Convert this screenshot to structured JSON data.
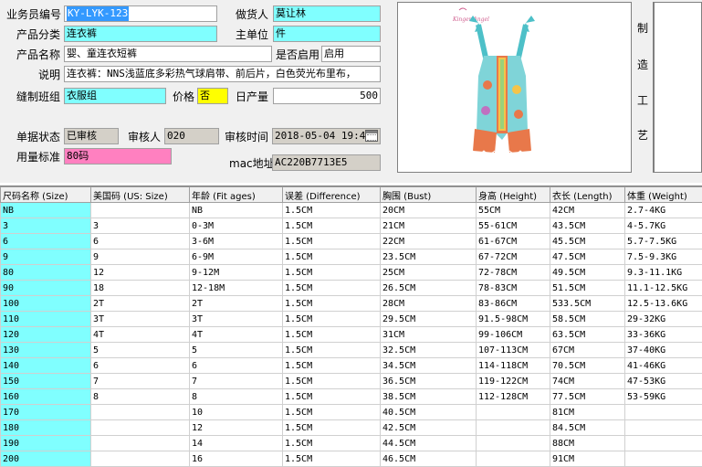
{
  "form": {
    "emp_label": "业务员编号",
    "emp_value": "KY-LYK-123",
    "maker_label": "做货人",
    "maker_value": "莫让林",
    "cat_label": "产品分类",
    "cat_value": "连衣裤",
    "unit_label": "主单位",
    "unit_value": "件",
    "name_label": "产品名称",
    "name_value": "婴、童连衣短裤",
    "enabled_label": "是否启用",
    "enabled_value": "启用",
    "desc_label": "说明",
    "desc_value": "连衣裤：NNS浅蓝底多彩热气球肩带、前后片，白色荧光布里布，",
    "team_label": "缝制班组",
    "team_value": "衣服组",
    "price_label": "价格",
    "price_value": "否",
    "daily_label": "日产量",
    "daily_value": "500",
    "status_label": "单据状态",
    "status_value": "已审核",
    "reviewer_label": "审核人",
    "reviewer_value": "020",
    "time_label": "审核时间",
    "time_value": "2018-05-04  19:4",
    "usage_label": "用量标准",
    "usage_value": "80码",
    "mac_label": "mac地址",
    "mac_value": "AC220B7713E5"
  },
  "side": {
    "c1": "制",
    "c2": "造",
    "c3": "工",
    "c4": "艺"
  },
  "icons": {
    "calendar": "calendar-icon",
    "row_marker": "row-pointer-icon"
  },
  "colors": {
    "highlight": "#80ffff",
    "usage": "#ff80c0",
    "price": "#ffff00",
    "selection": "#3399ff"
  },
  "grid": {
    "headers": [
      "尺码名称 (Size)",
      "美国码 (US: Size)",
      "年龄 (Fit ages)",
      "误差 (Difference)",
      "胸围 (Bust)",
      "身高 (Height)",
      "衣长 (Length)",
      "体重 (Weight)"
    ],
    "rows": [
      [
        "NB",
        "",
        "NB",
        "1.5CM",
        "20CM",
        "55CM",
        "42CM",
        "2.7-4KG"
      ],
      [
        "3",
        "3",
        "0-3M",
        "1.5CM",
        "21CM",
        "55-61CM",
        "43.5CM",
        "4-5.7KG"
      ],
      [
        "6",
        "6",
        "3-6M",
        "1.5CM",
        "22CM",
        "61-67CM",
        "45.5CM",
        "5.7-7.5KG"
      ],
      [
        "9",
        "9",
        "6-9M",
        "1.5CM",
        "23.5CM",
        "67-72CM",
        "47.5CM",
        "7.5-9.3KG"
      ],
      [
        "80",
        "12",
        "9-12M",
        "1.5CM",
        "25CM",
        "72-78CM",
        "49.5CM",
        "9.3-11.1KG"
      ],
      [
        "90",
        "18",
        "12-18M",
        "1.5CM",
        "26.5CM",
        "78-83CM",
        "51.5CM",
        "11.1-12.5KG"
      ],
      [
        "100",
        "2T",
        "2T",
        "1.5CM",
        "28CM",
        "83-86CM",
        "533.5CM",
        "12.5-13.6KG"
      ],
      [
        "110",
        "3T",
        "3T",
        "1.5CM",
        "29.5CM",
        "91.5-98CM",
        "58.5CM",
        "29-32KG"
      ],
      [
        "120",
        "4T",
        "4T",
        "1.5CM",
        "31CM",
        "99-106CM",
        "63.5CM",
        "33-36KG"
      ],
      [
        "130",
        "5",
        "5",
        "1.5CM",
        "32.5CM",
        "107-113CM",
        "67CM",
        "37-40KG"
      ],
      [
        "140",
        "6",
        "6",
        "1.5CM",
        "34.5CM",
        "114-118CM",
        "70.5CM",
        "41-46KG"
      ],
      [
        "150",
        "7",
        "7",
        "1.5CM",
        "36.5CM",
        "119-122CM",
        "74CM",
        "47-53KG"
      ],
      [
        "160",
        "8",
        "8",
        "1.5CM",
        "38.5CM",
        "112-128CM",
        "77.5CM",
        "53-59KG"
      ],
      [
        "170",
        "",
        "10",
        "1.5CM",
        "40.5CM",
        "",
        "81CM",
        ""
      ],
      [
        "180",
        "",
        "12",
        "1.5CM",
        "42.5CM",
        "",
        "84.5CM",
        ""
      ],
      [
        "190",
        "",
        "14",
        "1.5CM",
        "44.5CM",
        "",
        "88CM",
        ""
      ],
      [
        "200",
        "",
        "16",
        "1.5CM",
        "46.5CM",
        "",
        "91CM",
        ""
      ]
    ]
  }
}
